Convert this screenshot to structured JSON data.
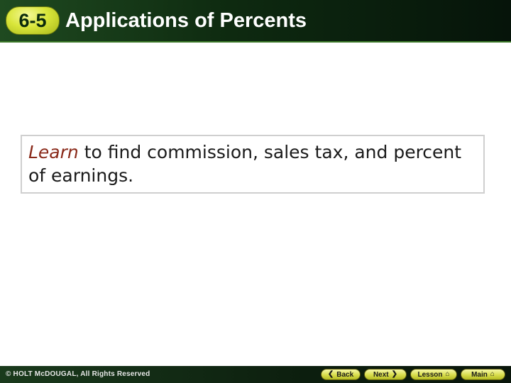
{
  "header": {
    "badge": "6-5",
    "title": "Applications of Percents"
  },
  "objective": {
    "lead": "Learn",
    "text": " to find commission, sales tax, and percent of earnings."
  },
  "footer": {
    "copyright": "© HOLT McDOUGAL, All Rights Reserved",
    "nav": {
      "back": "Back",
      "next": "Next",
      "lesson": "Lesson",
      "main": "Main"
    }
  },
  "icons": {
    "back": "chevron-left-icon",
    "next": "chevron-right-icon",
    "lesson": "home-icon",
    "main": "home-icon"
  },
  "colors": {
    "header_bg": "#0e2a10",
    "badge": "#d9e63a",
    "lead_text": "#8a2a1a",
    "nav_button": "#d8dd4c"
  }
}
